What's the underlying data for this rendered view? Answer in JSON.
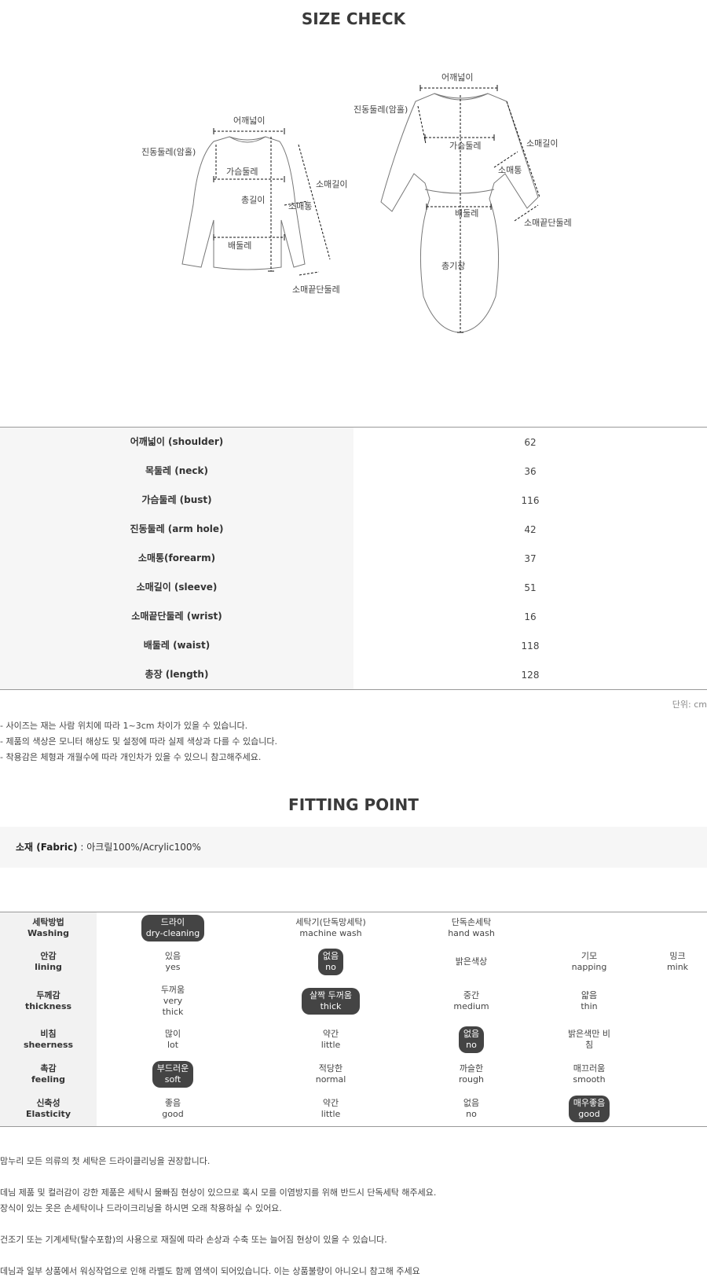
{
  "size_title": "SIZE CHECK",
  "diagram_labels": {
    "shoulder": "어깨넓이",
    "armhole": "진동둘레(암홀)",
    "bust": "가슴둘레",
    "total_length": "총길이",
    "forearm": "소매통",
    "sleeve": "소매길이",
    "waist": "배둘레",
    "wrist": "소매끝단둘레",
    "dress_length": "총기장"
  },
  "size_table": [
    {
      "label": "어깨넓이 (shoulder)",
      "value": "62"
    },
    {
      "label": "목둘레 (neck)",
      "value": "36"
    },
    {
      "label": "가슴둘레 (bust)",
      "value": "116"
    },
    {
      "label": "진동둘레 (arm hole)",
      "value": "42"
    },
    {
      "label": "소매통(forearm)",
      "value": "37"
    },
    {
      "label": "소매길이 (sleeve)",
      "value": "51"
    },
    {
      "label": "소매끝단둘레 (wrist)",
      "value": "16"
    },
    {
      "label": "배둘레 (waist)",
      "value": "118"
    },
    {
      "label": "총장 (length)",
      "value": "128"
    }
  ],
  "unit": "단위: cm",
  "notes": [
    "- 사이즈는 재는 사람 위치에 따라 1~3cm 차이가 있을 수 있습니다.",
    "- 제품의 색상은 모니터 해상도 및 설정에 따라 실제 색상과 다를 수 있습니다.",
    "- 착용감은 체형과 개월수에 따라 개인차가 있을 수 있으니 참고해주세요."
  ],
  "fit_title": "FITTING POINT",
  "fabric": {
    "label": "소재 (Fabric)",
    "value": " : 아크릴100%/Acrylic100%"
  },
  "fitting": [
    {
      "head_ko": "세탁방법",
      "head_en": "Washing",
      "options": [
        {
          "ko": "드라이",
          "en": "dry-cleaning",
          "selected": true
        },
        {
          "ko": "세탁기(단독망세탁)",
          "en": "machine wash",
          "selected": false
        },
        {
          "ko": "단독손세탁",
          "en": "hand wash",
          "selected": false
        },
        {
          "ko": "",
          "en": "",
          "selected": false
        },
        {
          "ko": "",
          "en": "",
          "selected": false
        }
      ]
    },
    {
      "head_ko": "안감",
      "head_en": "lining",
      "options": [
        {
          "ko": "있음",
          "en": "yes",
          "selected": false
        },
        {
          "ko": "없음",
          "en": "no",
          "selected": true
        },
        {
          "ko": "밝은색상",
          "en": "",
          "selected": false
        },
        {
          "ko": "기모",
          "en": "napping",
          "selected": false
        },
        {
          "ko": "밍크",
          "en": "mink",
          "selected": false
        }
      ]
    },
    {
      "head_ko": "두께감",
      "head_en": "thickness",
      "options": [
        {
          "ko": "두꺼움",
          "en": "very thick",
          "selected": false
        },
        {
          "ko": "살짝 두꺼움",
          "en": "thick",
          "selected": true
        },
        {
          "ko": "중간",
          "en": "medium",
          "selected": false
        },
        {
          "ko": "얇음",
          "en": "thin",
          "selected": false
        },
        {
          "ko": "",
          "en": "",
          "selected": false
        }
      ]
    },
    {
      "head_ko": "비침",
      "head_en": "sheerness",
      "options": [
        {
          "ko": "많이",
          "en": "lot",
          "selected": false
        },
        {
          "ko": "약간",
          "en": "little",
          "selected": false
        },
        {
          "ko": "없음",
          "en": "no",
          "selected": true
        },
        {
          "ko": "밝은색만 비침",
          "en": "",
          "selected": false
        },
        {
          "ko": "",
          "en": "",
          "selected": false
        }
      ]
    },
    {
      "head_ko": "촉감",
      "head_en": "feeling",
      "options": [
        {
          "ko": "부드러운",
          "en": "soft",
          "selected": true
        },
        {
          "ko": "적당한",
          "en": "normal",
          "selected": false
        },
        {
          "ko": "까슬한",
          "en": "rough",
          "selected": false
        },
        {
          "ko": "매끄러움",
          "en": "smooth",
          "selected": false
        },
        {
          "ko": "",
          "en": "",
          "selected": false
        }
      ]
    },
    {
      "head_ko": "신축성",
      "head_en": "Elasticity",
      "options": [
        {
          "ko": "좋음",
          "en": "good",
          "selected": false
        },
        {
          "ko": "약간",
          "en": "little",
          "selected": false
        },
        {
          "ko": "없음",
          "en": "no",
          "selected": false
        },
        {
          "ko": "매우좋음",
          "en": "good",
          "selected": true
        },
        {
          "ko": "",
          "en": "",
          "selected": false
        }
      ]
    }
  ],
  "care_notes": [
    "맘누리 모든 의류의 첫 세탁은 드라이클리닝을 권장합니다.",
    "",
    "데님 제품 및 컬러감이 강한 제품은 세탁시 물빠짐 현상이 있으므로 혹시 모를 이염방지를 위해 반드시 단독세탁 해주세요.",
    "장식이 있는 옷은 손세탁이나 드라이크리닝을 하시면 오래 착용하실 수 있어요.",
    "",
    "건조기 또는 기계세탁(탈수포함)의 사용으로 재질에 따라 손상과 수축 또는 늘어짐 현상이 있을 수 있습니다.",
    "",
    "데님과 일부 상품에서 워싱작업으로 인해 라벨도 함께 염색이 되어있습니다. 이는 상품불량이 아니오니 참고해 주세요"
  ]
}
